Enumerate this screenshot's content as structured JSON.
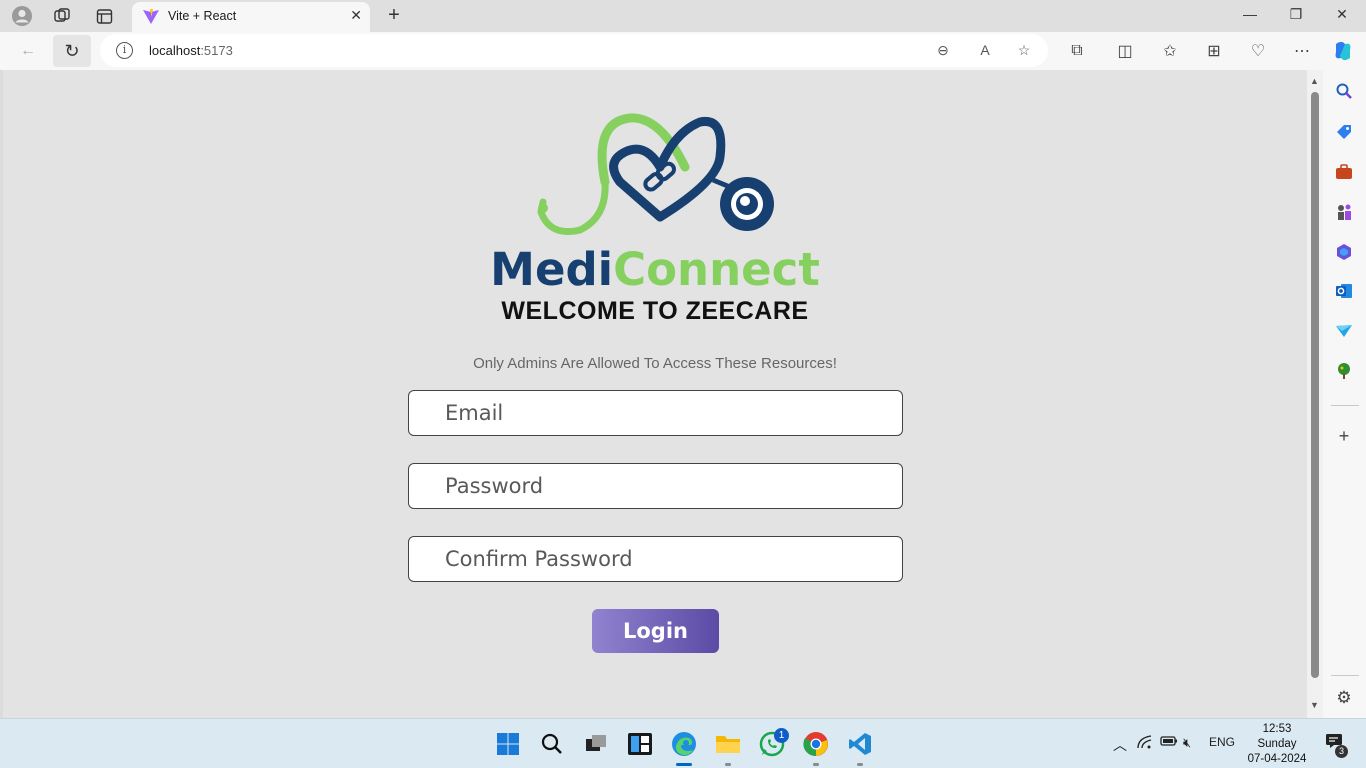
{
  "browser": {
    "tab_title": "Vite + React",
    "url_host": "localhost",
    "url_port": ":5173",
    "icons": [
      "profile-icon",
      "workspaces-icon",
      "tab-actions-icon",
      "back-icon",
      "refresh-icon",
      "info-icon",
      "zoom-out-icon",
      "read-aloud-icon",
      "favorite-icon",
      "extensions-icon",
      "split-screen-icon",
      "favorites-icon",
      "collections-icon",
      "browser-essentials-icon",
      "more-icon",
      "copilot-icon"
    ]
  },
  "page": {
    "brand_part1": "Medi",
    "brand_part2": "Connect",
    "welcome": "WELCOME TO ZEECARE",
    "notice": "Only Admins Are Allowed To Access These Resources!",
    "email_placeholder": "Email",
    "password_placeholder": "Password",
    "confirm_placeholder": "Confirm Password",
    "login_label": "Login",
    "colors": {
      "brand_blue": "#174070",
      "brand_green": "#86d060",
      "button_start": "#9183cf",
      "button_end": "#5b4ba6"
    }
  },
  "taskbar": {
    "language": "ENG",
    "time": "12:53",
    "day": "Sunday",
    "date": "07-04-2024",
    "whatsapp_badge": "1",
    "notification_badge": "3"
  }
}
